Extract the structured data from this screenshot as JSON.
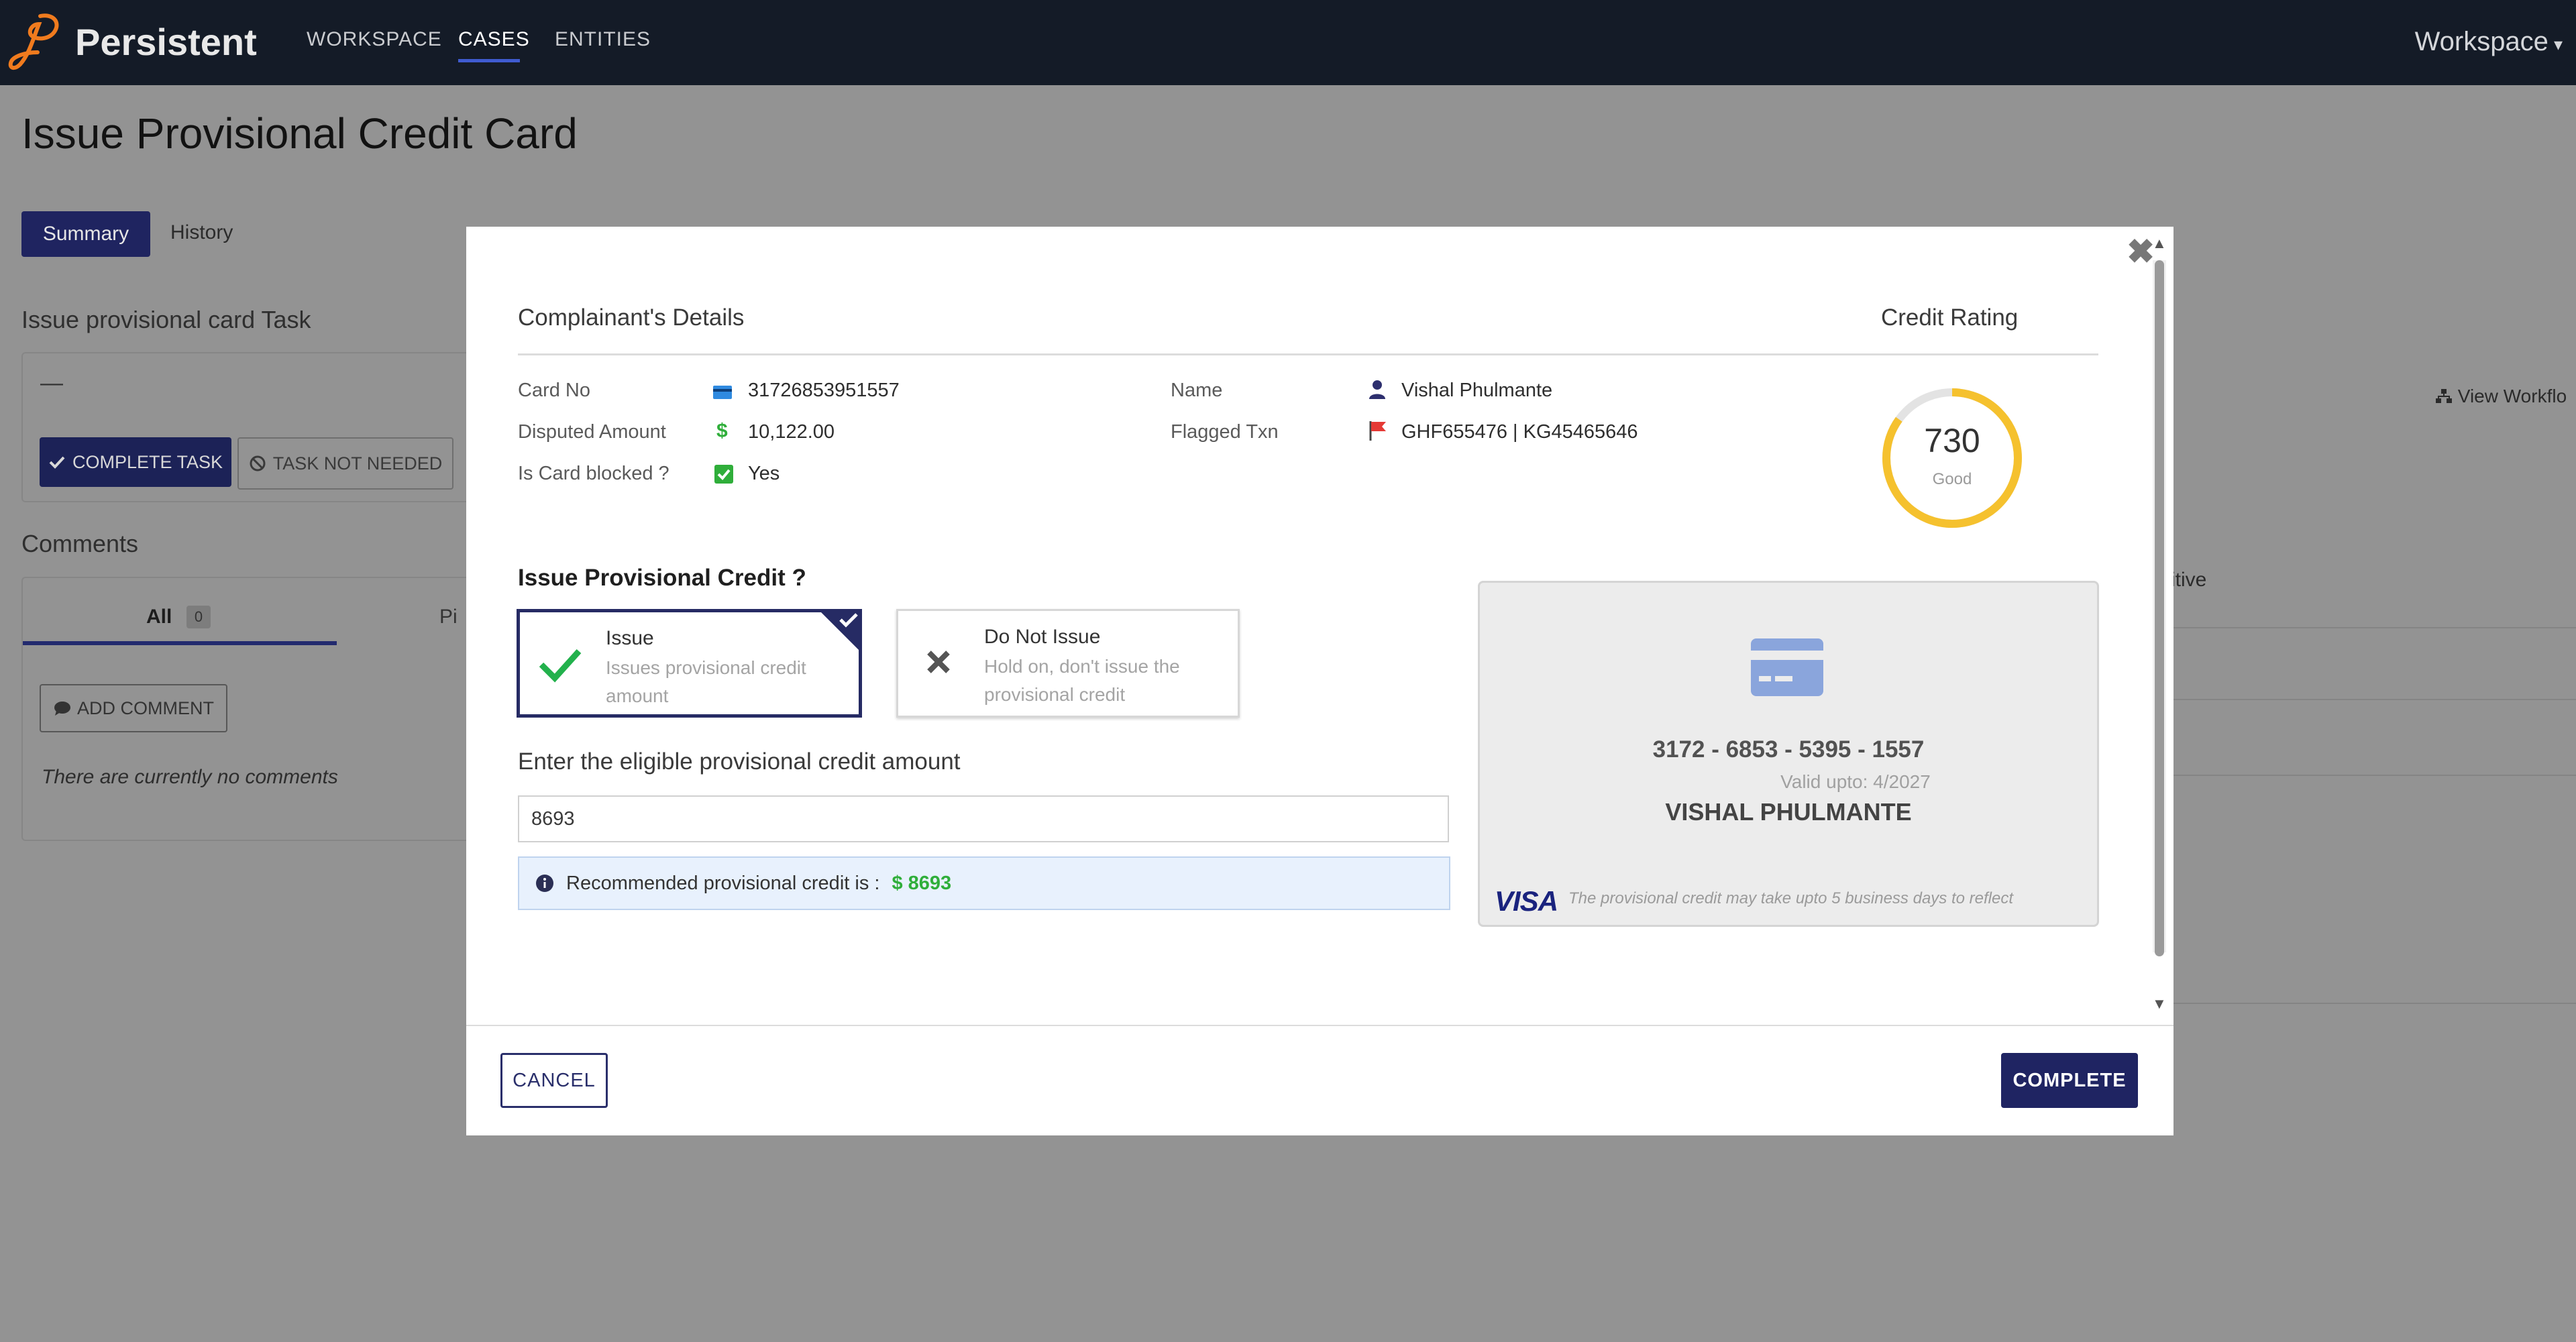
{
  "nav": {
    "brand": "Persistent",
    "items": [
      "WORKSPACE",
      "CASES",
      "ENTITIES"
    ],
    "active": "CASES",
    "workspace_label": "Workspace",
    "workspace_caret": "▾"
  },
  "page": {
    "title": "Issue Provisional Credit Card",
    "tabs": [
      "Summary",
      "History"
    ],
    "task_section_title": "Issue provisional card Task",
    "task_placeholder": "—",
    "complete_task_label": "COMPLETE TASK",
    "task_not_needed_label": "TASK NOT NEEDED",
    "comments_title": "Comments",
    "comments_tabs": [
      {
        "label": "All",
        "count": "0"
      },
      {
        "label": "Pi"
      }
    ],
    "add_comment_label": "ADD COMMENT",
    "no_comments_text": "There are currently no comments",
    "view_workflow_label": "View Workflo",
    "right_partial_text": "itive"
  },
  "modal": {
    "close_glyph": "✖",
    "complainant_title": "Complainant's Details",
    "credit_rating_title": "Credit Rating",
    "details": {
      "card_no": {
        "label": "Card No",
        "value": "31726853951557"
      },
      "disputed_amount": {
        "label": "Disputed Amount",
        "value": "10,122.00"
      },
      "card_blocked": {
        "label": "Is Card blocked ?",
        "value": "Yes"
      },
      "name": {
        "label": "Name",
        "value": "Vishal  Phulmante"
      },
      "flagged_txn": {
        "label": "Flagged Txn",
        "value": "GHF655476 | KG45465646"
      }
    },
    "credit_rating": {
      "score": "730",
      "label": "Good",
      "fill_fraction": 0.85
    },
    "question": "Issue Provisional Credit ?",
    "options": {
      "issue": {
        "title": "Issue",
        "desc": "Issues provisional credit amount",
        "selected": true
      },
      "do_not_issue": {
        "title": "Do Not Issue",
        "desc": "Hold on, don't issue the provisional credit",
        "selected": false
      }
    },
    "amount_label": "Enter the eligible provisional credit amount",
    "amount_value": "8693",
    "recommendation_text": "Recommended provisional credit is :",
    "recommendation_amount": "$ 8693",
    "card": {
      "number": "3172 - 6853 - 5395 - 1557",
      "valid": "Valid upto: 4/2027",
      "holder": "VISHAL PHULMANTE",
      "network": "VISA",
      "note": "The provisional credit may take upto 5 business days to reflect"
    },
    "cancel_label": "CANCEL",
    "complete_label": "COMPLETE"
  },
  "colors": {
    "navbar": "#141b27",
    "overlay": "#939393",
    "primary": "#1f2462",
    "rating_ring": "#f5c12e",
    "success": "#2fae3a"
  }
}
